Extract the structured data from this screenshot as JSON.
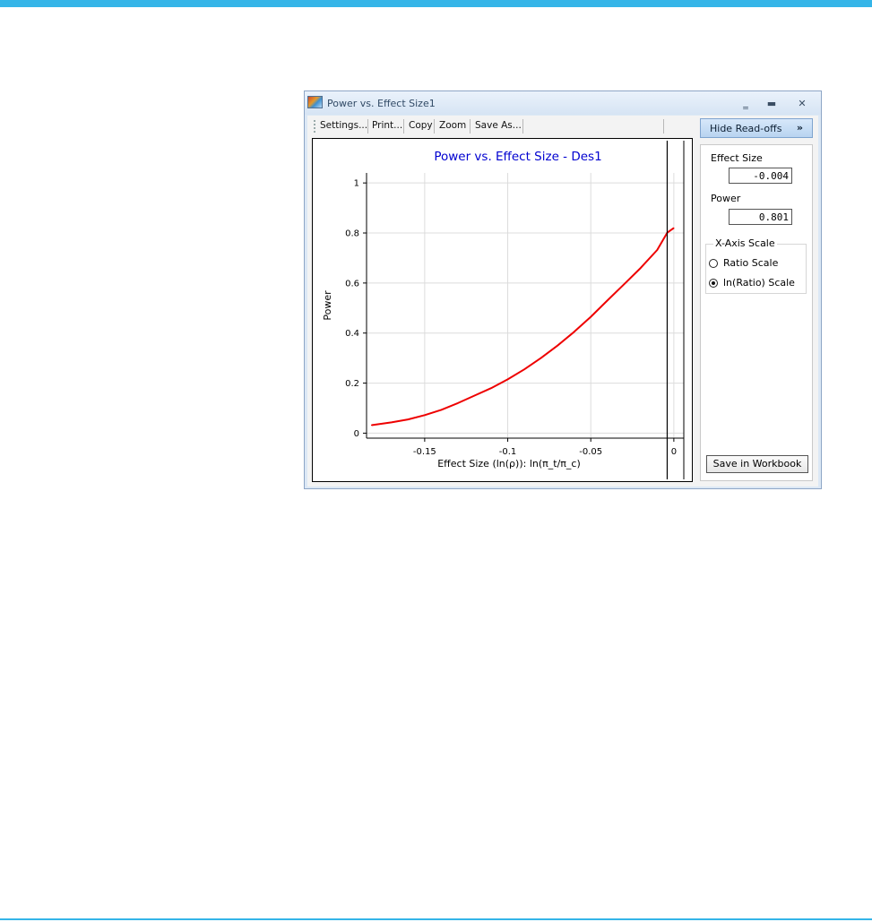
{
  "window": {
    "title": "Power vs. Effect Size1",
    "minimize_glyph": "‗",
    "maximize_glyph": "▬",
    "close_glyph": "✕"
  },
  "toolbar": {
    "items": [
      "Settings...",
      "Print...",
      "Copy",
      "Zoom",
      "Save As..."
    ]
  },
  "side_panel": {
    "hide_readoffs_label": "Hide Read-offs",
    "hide_readoffs_chevron": "»",
    "effect_size_label": "Effect Size",
    "effect_size_value": "-0.004",
    "power_label": "Power",
    "power_value": "0.801",
    "x_axis_scale_legend": "X-Axis Scale",
    "ratio_scale_label": "Ratio Scale",
    "ln_ratio_scale_label": "ln(Ratio) Scale",
    "selected_scale": "ln(Ratio) Scale",
    "save_in_workbook_label": "Save in Workbook"
  },
  "colors": {
    "accent_bar": "#35b5e8",
    "title_text": "#0000d0",
    "curve": "#ee0000"
  },
  "chart_data": {
    "type": "line",
    "title": "Power vs. Effect Size - Des1",
    "xlabel": "Effect Size (ln(ρ)): ln(π_t/π_c)",
    "ylabel": "Power",
    "xlim": [
      -0.185,
      0.006
    ],
    "ylim": [
      -0.02,
      1.04
    ],
    "xticks": [
      -0.15,
      -0.1,
      -0.05,
      0
    ],
    "xtick_labels": [
      "-0.15",
      "-0.1",
      "-0.05",
      "0"
    ],
    "yticks": [
      0,
      0.2,
      0.4,
      0.6,
      0.8,
      1
    ],
    "ytick_labels": [
      "0",
      "0.2",
      "0.4",
      "0.6",
      "0.8",
      "1"
    ],
    "grid": true,
    "series": [
      {
        "x": [
          -0.182,
          -0.17,
          -0.16,
          -0.15,
          -0.14,
          -0.13,
          -0.12,
          -0.11,
          -0.1,
          -0.09,
          -0.08,
          -0.07,
          -0.06,
          -0.05,
          -0.04,
          -0.03,
          -0.02,
          -0.01,
          -0.004,
          0.0
        ],
        "y": [
          0.032,
          0.043,
          0.055,
          0.072,
          0.093,
          0.12,
          0.15,
          0.18,
          0.215,
          0.255,
          0.3,
          0.35,
          0.405,
          0.465,
          0.53,
          0.595,
          0.66,
          0.732,
          0.801,
          0.82
        ]
      }
    ],
    "cursor_x": -0.004
  }
}
